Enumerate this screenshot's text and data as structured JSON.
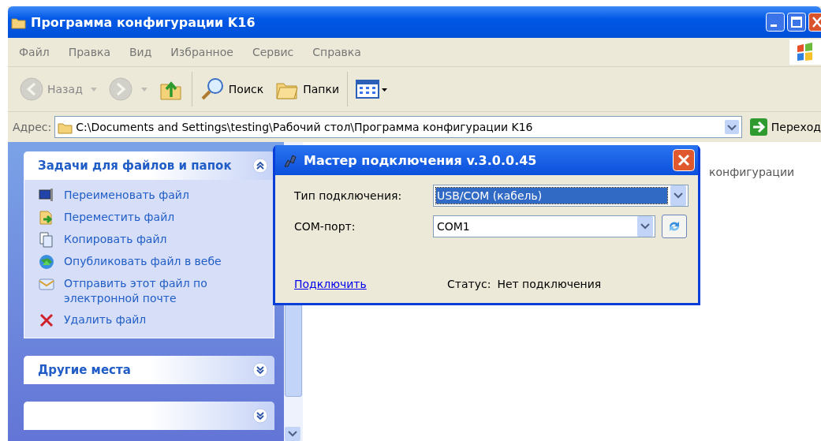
{
  "window": {
    "title": "Программа конфигурации K16"
  },
  "menu": [
    "Файл",
    "Правка",
    "Вид",
    "Избранное",
    "Сервис",
    "Справка"
  ],
  "toolbar": [
    {
      "kind": "back",
      "label": "Назад",
      "disabled": true
    },
    {
      "kind": "forward",
      "disabled": true
    },
    {
      "kind": "up",
      "disabled": false
    },
    {
      "kind": "search",
      "label": "Поиск",
      "disabled": false
    },
    {
      "kind": "folders",
      "label": "Папки",
      "disabled": false
    },
    {
      "kind": "views",
      "disabled": false
    }
  ],
  "address": {
    "label": "Адрес:",
    "value": "C:\\Documents and Settings\\testing\\Рабочий стол\\Программа конфигурации K16",
    "go_label": "Переход"
  },
  "sidebar": {
    "panels": [
      {
        "title": "Задачи для файлов и папок",
        "expanded": true,
        "items": [
          {
            "kind": "rename",
            "label": "Переименовать файл"
          },
          {
            "kind": "move",
            "label": "Переместить файл"
          },
          {
            "kind": "copy",
            "label": "Копировать файл"
          },
          {
            "kind": "publish",
            "label": "Опубликовать файл в вебе"
          },
          {
            "kind": "email",
            "label": "Отправить этот файл по электронной почте"
          },
          {
            "kind": "delete",
            "label": "Удалить файл"
          }
        ]
      },
      {
        "title": "Другие места",
        "expanded": false
      },
      {
        "expanded": false
      }
    ]
  },
  "content": {
    "file_label": "конфигурации"
  },
  "dialog": {
    "title": "Мастер подключения v.3.0.0.45",
    "fields": [
      {
        "kind": "combo",
        "label": "Тип подключения:",
        "value": "USB/COM (кабель)",
        "selected": true
      },
      {
        "kind": "combo_refresh",
        "label": "COM-порт:",
        "value": "COM1",
        "selected": false
      }
    ],
    "link": "Подключить",
    "status_label": "Статус:",
    "status_value": "Нет подключения"
  }
}
